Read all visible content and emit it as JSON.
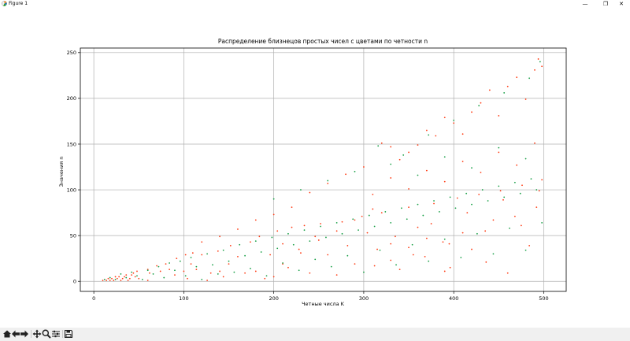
{
  "window": {
    "title": "Figure 1",
    "minimize_glyph": "—",
    "maximize_glyph": "❐",
    "close_glyph": "✕"
  },
  "toolbar": {
    "buttons": [
      "home-icon",
      "back-arrow-icon",
      "forward-arrow-icon",
      "pan-icon",
      "zoom-icon",
      "configure-subplots-icon",
      "save-icon"
    ]
  },
  "colors": {
    "odd": "#ff3c14",
    "even": "#1aa048"
  },
  "chart_data": {
    "type": "scatter",
    "title": "Распределение близнецов простых чисел с цветами по четности n",
    "xlabel": "Четные числа K",
    "ylabel": "Значения n",
    "xlim": [
      -15,
      525
    ],
    "ylim": [
      -11,
      255
    ],
    "xticks": [
      "0",
      "100",
      "200",
      "300",
      "400",
      "500"
    ],
    "yticks": [
      "0",
      "50",
      "100",
      "150",
      "200",
      "250"
    ],
    "xtick_values": [
      0,
      100,
      200,
      300,
      400,
      500
    ],
    "ytick_values": [
      0,
      50,
      100,
      150,
      200,
      250
    ],
    "grid": true,
    "series": [
      {
        "color_key": "odd",
        "points": [
          [
            10,
            1
          ],
          [
            14,
            1
          ],
          [
            16,
            3
          ],
          [
            18,
            1
          ],
          [
            20,
            3
          ],
          [
            22,
            1
          ],
          [
            24,
            5
          ],
          [
            26,
            3
          ],
          [
            28,
            5
          ],
          [
            30,
            1
          ],
          [
            32,
            3
          ],
          [
            34,
            5
          ],
          [
            36,
            7
          ],
          [
            38,
            1
          ],
          [
            40,
            3
          ],
          [
            42,
            7
          ],
          [
            44,
            9
          ],
          [
            46,
            5
          ],
          [
            48,
            11
          ],
          [
            50,
            3
          ],
          [
            60,
            1
          ],
          [
            60,
            13
          ],
          [
            62,
            9
          ],
          [
            70,
            17
          ],
          [
            74,
            11
          ],
          [
            80,
            19
          ],
          [
            84,
            13
          ],
          [
            90,
            7
          ],
          [
            92,
            25
          ],
          [
            100,
            11
          ],
          [
            102,
            29
          ],
          [
            104,
            3
          ],
          [
            108,
            19
          ],
          [
            110,
            31
          ],
          [
            114,
            13
          ],
          [
            120,
            29
          ],
          [
            126,
            1
          ],
          [
            130,
            9
          ],
          [
            138,
            33
          ],
          [
            140,
            11
          ],
          [
            144,
            5
          ],
          [
            150,
            19
          ],
          [
            152,
            39
          ],
          [
            160,
            27
          ],
          [
            168,
            9
          ],
          [
            174,
            43
          ],
          [
            180,
            11
          ],
          [
            184,
            49
          ],
          [
            190,
            3
          ],
          [
            196,
            29
          ],
          [
            200,
            5
          ],
          [
            204,
            55
          ],
          [
            210,
            41
          ],
          [
            216,
            15
          ],
          [
            220,
            59
          ],
          [
            228,
            35
          ],
          [
            234,
            61
          ],
          [
            240,
            9
          ],
          [
            246,
            49
          ],
          [
            252,
            63
          ],
          [
            260,
            29
          ],
          [
            270,
            7
          ],
          [
            276,
            65
          ],
          [
            282,
            39
          ],
          [
            290,
            19
          ],
          [
            298,
            71
          ],
          [
            304,
            53
          ],
          [
            312,
            17
          ],
          [
            320,
            75
          ],
          [
            330,
            41
          ],
          [
            340,
            13
          ],
          [
            350,
            81
          ],
          [
            360,
            59
          ],
          [
            368,
            27
          ],
          [
            378,
            85
          ],
          [
            388,
            43
          ],
          [
            396,
            15
          ],
          [
            404,
            91
          ],
          [
            410,
            53
          ],
          [
            420,
            35
          ],
          [
            428,
            95
          ],
          [
            436,
            21
          ],
          [
            444,
            67
          ],
          [
            452,
            99
          ],
          [
            460,
            9
          ],
          [
            468,
            71
          ],
          [
            476,
            105
          ],
          [
            484,
            39
          ],
          [
            492,
            81
          ],
          [
            498,
            111
          ],
          [
            320,
            151
          ],
          [
            330,
            147
          ],
          [
            350,
            141
          ],
          [
            370,
            165
          ],
          [
            390,
            179
          ],
          [
            410,
            161
          ],
          [
            430,
            195
          ],
          [
            450,
            181
          ],
          [
            460,
            213
          ],
          [
            470,
            223
          ],
          [
            480,
            199
          ],
          [
            490,
            231
          ],
          [
            494,
            243
          ],
          [
            498,
            235
          ],
          [
            440,
            209
          ],
          [
            420,
            185
          ],
          [
            400,
            173
          ],
          [
            380,
            159
          ],
          [
            360,
            149
          ],
          [
            340,
            133
          ],
          [
            300,
            125
          ],
          [
            280,
            117
          ],
          [
            260,
            107
          ],
          [
            240,
            97
          ],
          [
            220,
            81
          ],
          [
            200,
            73
          ],
          [
            180,
            67
          ],
          [
            160,
            57
          ],
          [
            140,
            49
          ],
          [
            120,
            43
          ],
          [
            310,
            95
          ],
          [
            330,
            113
          ],
          [
            350,
            101
          ],
          [
            370,
            121
          ],
          [
            390,
            109
          ],
          [
            410,
            131
          ],
          [
            430,
            119
          ],
          [
            450,
            141
          ],
          [
            470,
            127
          ],
          [
            490,
            151
          ],
          [
            315,
            35
          ],
          [
            335,
            49
          ],
          [
            355,
            29
          ],
          [
            375,
            63
          ],
          [
            395,
            41
          ],
          [
            415,
            75
          ],
          [
            435,
            55
          ],
          [
            455,
            89
          ],
          [
            475,
            61
          ],
          [
            495,
            99
          ],
          [
            210,
            19
          ],
          [
            230,
            31
          ],
          [
            250,
            45
          ],
          [
            270,
            55
          ],
          [
            290,
            67
          ],
          [
            310,
            79
          ],
          [
            330,
            23
          ],
          [
            350,
            37
          ],
          [
            370,
            47
          ],
          [
            390,
            11
          ]
        ]
      },
      {
        "color_key": "even",
        "points": [
          [
            12,
            2
          ],
          [
            18,
            4
          ],
          [
            24,
            2
          ],
          [
            30,
            8
          ],
          [
            36,
            4
          ],
          [
            42,
            10
          ],
          [
            48,
            6
          ],
          [
            54,
            2
          ],
          [
            60,
            12
          ],
          [
            66,
            8
          ],
          [
            72,
            16
          ],
          [
            78,
            4
          ],
          [
            84,
            20
          ],
          [
            90,
            12
          ],
          [
            96,
            22
          ],
          [
            102,
            6
          ],
          [
            108,
            26
          ],
          [
            114,
            16
          ],
          [
            120,
            2
          ],
          [
            126,
            30
          ],
          [
            132,
            18
          ],
          [
            138,
            8
          ],
          [
            144,
            34
          ],
          [
            150,
            22
          ],
          [
            156,
            10
          ],
          [
            162,
            40
          ],
          [
            168,
            28
          ],
          [
            174,
            14
          ],
          [
            180,
            44
          ],
          [
            186,
            32
          ],
          [
            192,
            6
          ],
          [
            198,
            48
          ],
          [
            204,
            36
          ],
          [
            210,
            20
          ],
          [
            216,
            52
          ],
          [
            222,
            40
          ],
          [
            228,
            12
          ],
          [
            234,
            56
          ],
          [
            240,
            44
          ],
          [
            246,
            24
          ],
          [
            252,
            60
          ],
          [
            258,
            48
          ],
          [
            264,
            16
          ],
          [
            270,
            64
          ],
          [
            276,
            52
          ],
          [
            282,
            28
          ],
          [
            288,
            68
          ],
          [
            294,
            56
          ],
          [
            300,
            10
          ],
          [
            306,
            72
          ],
          [
            312,
            60
          ],
          [
            318,
            34
          ],
          [
            324,
            76
          ],
          [
            330,
            64
          ],
          [
            336,
            18
          ],
          [
            342,
            80
          ],
          [
            348,
            68
          ],
          [
            354,
            40
          ],
          [
            360,
            84
          ],
          [
            366,
            72
          ],
          [
            372,
            22
          ],
          [
            378,
            88
          ],
          [
            384,
            76
          ],
          [
            390,
            46
          ],
          [
            396,
            92
          ],
          [
            402,
            80
          ],
          [
            408,
            26
          ],
          [
            414,
            96
          ],
          [
            420,
            84
          ],
          [
            426,
            52
          ],
          [
            432,
            100
          ],
          [
            438,
            88
          ],
          [
            444,
            30
          ],
          [
            450,
            104
          ],
          [
            456,
            92
          ],
          [
            462,
            58
          ],
          [
            468,
            108
          ],
          [
            474,
            96
          ],
          [
            480,
            34
          ],
          [
            486,
            112
          ],
          [
            492,
            100
          ],
          [
            498,
            64
          ],
          [
            316,
            148
          ],
          [
            344,
            138
          ],
          [
            372,
            160
          ],
          [
            400,
            176
          ],
          [
            428,
            192
          ],
          [
            456,
            206
          ],
          [
            484,
            222
          ],
          [
            496,
            240
          ],
          [
            330,
            128
          ],
          [
            360,
            116
          ],
          [
            390,
            136
          ],
          [
            420,
            124
          ],
          [
            450,
            146
          ],
          [
            480,
            134
          ],
          [
            200,
            90
          ],
          [
            230,
            100
          ],
          [
            260,
            110
          ],
          [
            290,
            120
          ]
        ]
      }
    ]
  }
}
